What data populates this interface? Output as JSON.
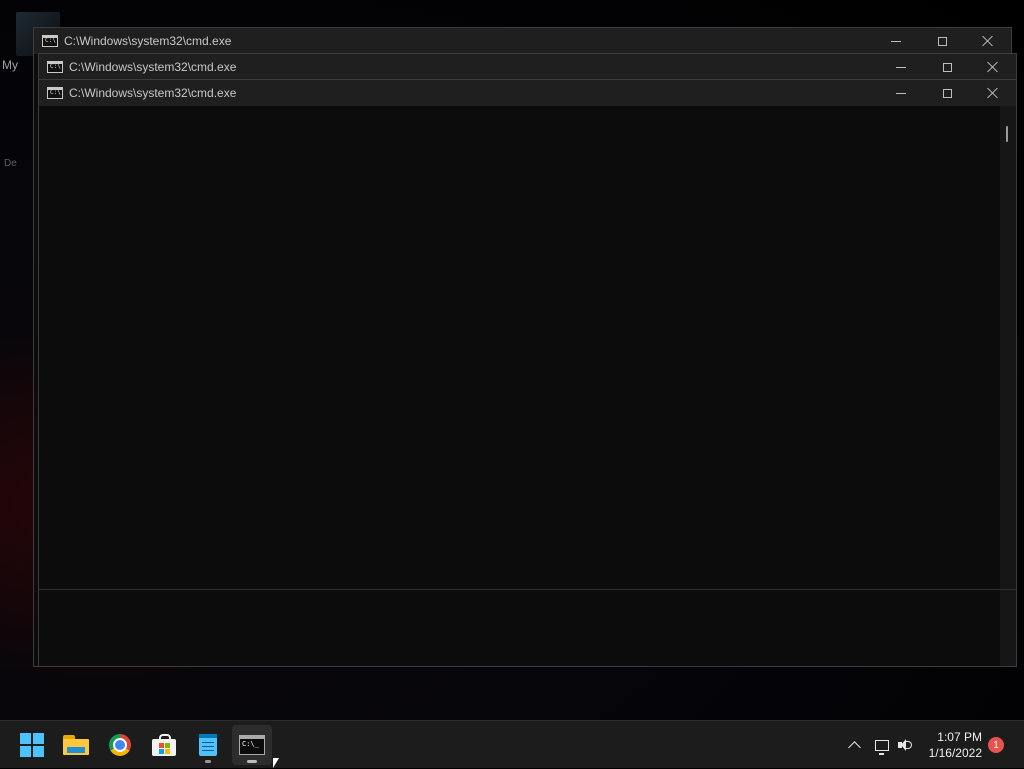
{
  "desktop": {
    "icon_label": "My",
    "icon_label_2": "De"
  },
  "windows": [
    {
      "title": "C:\\Windows\\system32\\cmd.exe"
    },
    {
      "title": "C:\\Windows\\system32\\cmd.exe"
    },
    {
      "title": "C:\\Windows\\system32\\cmd.exe"
    }
  ],
  "taskbar": {
    "apps": [
      {
        "name": "Start",
        "icon": "windows-start-icon",
        "active": false,
        "running": false
      },
      {
        "name": "File Explorer",
        "icon": "folder-icon",
        "active": false,
        "running": false
      },
      {
        "name": "Google Chrome",
        "icon": "chrome-icon",
        "active": false,
        "running": false
      },
      {
        "name": "Microsoft Store",
        "icon": "store-icon",
        "active": false,
        "running": false
      },
      {
        "name": "Notepad",
        "icon": "notepad-icon",
        "active": false,
        "running": true
      },
      {
        "name": "Command Prompt",
        "icon": "cmd-icon",
        "active": true,
        "running": true
      }
    ],
    "clock": {
      "time": "1:07 PM",
      "date": "1/16/2022"
    },
    "notification_count": "1"
  },
  "colors": {
    "accent": "#4cc2ff",
    "taskbar_bg": "#1c1c1c",
    "console_bg": "#0c0c0c",
    "badge": "#e8534e"
  }
}
